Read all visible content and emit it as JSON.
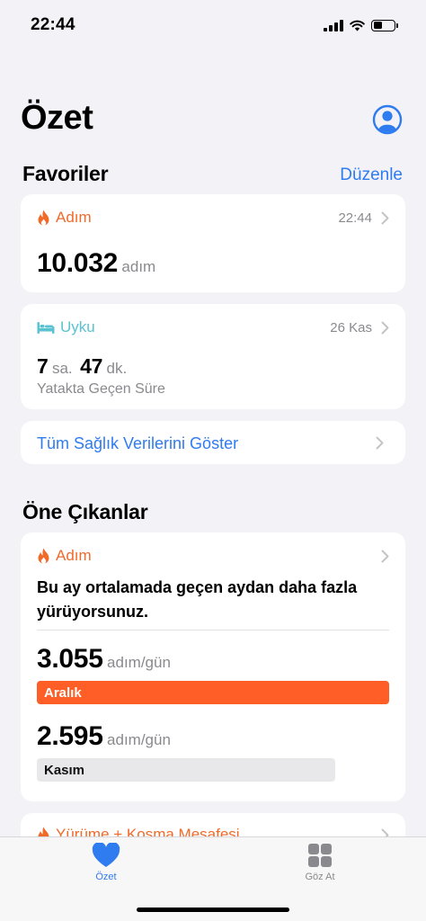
{
  "status": {
    "time": "22:44"
  },
  "header": {
    "title": "Özet",
    "profile_icon": "person-circle-icon"
  },
  "favorites": {
    "title": "Favoriler",
    "edit_label": "Düzenle",
    "steps": {
      "category": "Adım",
      "time": "22:44",
      "value": "10.032",
      "unit": "adım"
    },
    "sleep": {
      "category": "Uyku",
      "date": "26 Kas",
      "hours": "7",
      "hours_unit": "sa.",
      "minutes": "47",
      "minutes_unit": "dk.",
      "caption": "Yatakta Geçen Süre"
    },
    "show_all_label": "Tüm Sağlık Verilerini Göster"
  },
  "highlights": {
    "title": "Öne Çıkanlar",
    "card": {
      "category": "Adım",
      "text": "Bu ay ortalamada geçen aydan daha fazla yürüyorsunuz.",
      "current": {
        "value": "3.055",
        "unit": "adım/gün",
        "label": "Aralık"
      },
      "previous": {
        "value": "2.595",
        "unit": "adım/gün",
        "label": "Kasım"
      }
    },
    "next_card_category": "Yürüme + Koşma Mesafesi"
  },
  "tabs": [
    {
      "label": "Özet",
      "icon": "heart-icon",
      "active": true
    },
    {
      "label": "Göz At",
      "icon": "grid-icon",
      "active": false
    }
  ],
  "colors": {
    "accent": "#2f7bf0",
    "steps": "#ff5e26",
    "sleep": "#5ac2d0",
    "background": "#f2f2f7"
  }
}
